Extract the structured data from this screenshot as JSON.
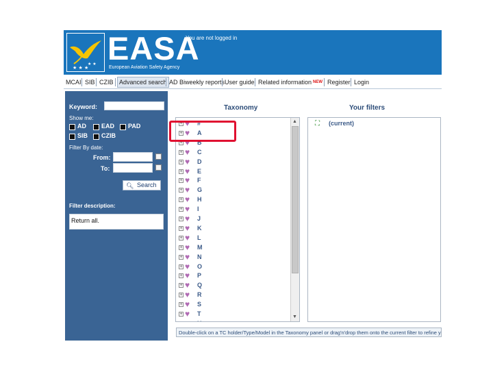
{
  "header": {
    "logo_text": "EASA",
    "logo_subtitle": "European Aviation Safety Agency",
    "login_status": "You are not logged in"
  },
  "nav": {
    "items": [
      {
        "label": "MCAI"
      },
      {
        "label": "SIB"
      },
      {
        "label": "CZIB"
      },
      {
        "label": "Advanced search"
      },
      {
        "label": "AD Biweekly reports"
      },
      {
        "label": "User guide"
      },
      {
        "label": "Related information"
      },
      {
        "label": "Register"
      },
      {
        "label": "Login"
      }
    ],
    "new_badge": "NEW"
  },
  "left_panel": {
    "keyword_label": "Keyword:",
    "keyword_value": "",
    "show_me_label": "Show me:",
    "checkboxes": [
      "AD",
      "EAD",
      "PAD",
      "SIB",
      "CZIB"
    ],
    "filter_by_date_label": "Filter By date:",
    "from_label": "From:",
    "to_label": "To:",
    "from_value": "",
    "to_value": "",
    "search_label": "Search",
    "filter_description_label": "Filter description:",
    "filter_description_value": "Return all."
  },
  "taxonomy": {
    "title": "Taxonomy",
    "items": [
      "#",
      "A",
      "B",
      "C",
      "D",
      "E",
      "F",
      "G",
      "H",
      "I",
      "J",
      "K",
      "L",
      "M",
      "N",
      "O",
      "P",
      "Q",
      "R",
      "S",
      "T",
      "U"
    ]
  },
  "filters": {
    "title": "Your filters",
    "current": "(current)"
  },
  "footer": {
    "hint": "Double-click on a TC holder/Type/Model in the Taxonomy panel or drag'n'drop them onto the current filter to refine your search."
  },
  "colors": {
    "header_blue": "#1a75bc",
    "panel_blue": "#3a6494",
    "highlight_red": "#e01030",
    "tree_text": "#3b5a88",
    "heart_purple": "#b06ab3"
  }
}
